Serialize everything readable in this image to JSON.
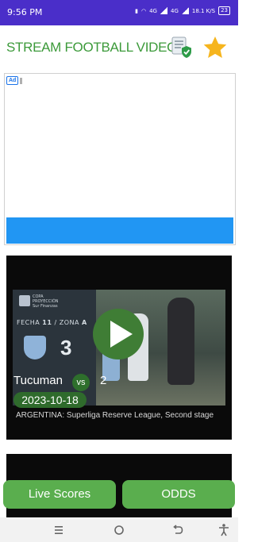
{
  "status_bar": {
    "time": "9:56 PM",
    "network_a": "4G",
    "network_b": "4G",
    "speed": "18.1 K/S",
    "battery": "23"
  },
  "header": {
    "title": "STREAM FOOTBALL VIDEOS"
  },
  "ad": {
    "badge": "Ad",
    "cta_color": "#2196f3"
  },
  "thumbnail": {
    "competition_line1": "COPA",
    "competition_line2": "PROYECCIÓN",
    "competition_line3": "Sur Finanzas",
    "fecha_label": "FECHA",
    "fecha_number": "11",
    "zona_label": "ZONA",
    "zona_letter": "A",
    "score": "3"
  },
  "match": {
    "home_team": "Tucuman",
    "vs_label": "vs",
    "away_team": "2",
    "date": "2023-10-18",
    "league": "ARGENTINA: Superliga Reserve League, Second stage"
  },
  "buttons": {
    "live_scores": "Live Scores",
    "odds": "ODDS"
  },
  "colors": {
    "status_bar": "#4a2ec9",
    "title_green": "#3c9a3a",
    "button_green": "#5aae4e",
    "star": "#f6b51e"
  }
}
